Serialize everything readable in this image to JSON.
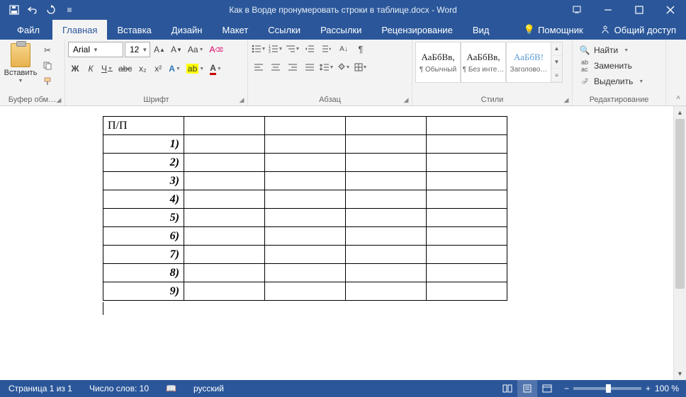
{
  "title": "Как в Ворде пронумеровать строки в таблице.docx - Word",
  "qat": {
    "save": "save-icon",
    "undo": "undo-icon",
    "redo": "redo-icon"
  },
  "tabs": {
    "file": "Файл",
    "home": "Главная",
    "insert": "Вставка",
    "design": "Дизайн",
    "layout": "Макет",
    "references": "Ссылки",
    "mailings": "Рассылки",
    "review": "Рецензирование",
    "view": "Вид",
    "assistant": "Помощник",
    "share": "Общий доступ"
  },
  "ribbon": {
    "clipboard": {
      "paste": "Вставить",
      "label": "Буфер обм…"
    },
    "font": {
      "name": "Arial",
      "size": "12",
      "label": "Шрифт",
      "bold": "Ж",
      "italic": "К",
      "underline": "Ч",
      "strike": "abc",
      "sub": "x₂",
      "sup": "x²"
    },
    "paragraph": {
      "label": "Абзац"
    },
    "styles": {
      "label": "Стили",
      "s1": {
        "preview": "АаБбВв,",
        "name": "¶ Обычный"
      },
      "s2": {
        "preview": "АаБбВв,",
        "name": "¶ Без инте…"
      },
      "s3": {
        "preview": "АаБбВ!",
        "name": "Заголово…"
      }
    },
    "editing": {
      "label": "Редактирование",
      "find": "Найти",
      "replace": "Заменить",
      "select": "Выделить"
    }
  },
  "doc": {
    "header": "П/П",
    "rows": [
      "1)",
      "2)",
      "3)",
      "4)",
      "5)",
      "6)",
      "7)",
      "8)",
      "9)"
    ]
  },
  "status": {
    "page": "Страница 1 из 1",
    "words": "Число слов: 10",
    "lang": "русский",
    "zoom": "100 %"
  }
}
